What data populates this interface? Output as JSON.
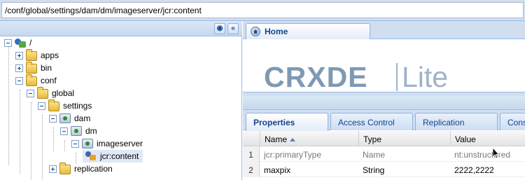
{
  "address": {
    "path": "/conf/global/settings/dam/dm/imageserver/jcr:content"
  },
  "left_header": {
    "buttons": [
      "binoculars-icon",
      "collapse-icon"
    ],
    "collapse_glyph": "«"
  },
  "tree": {
    "nodes": [
      {
        "label": "/",
        "toggle": "minus",
        "icon": "root"
      },
      {
        "label": "apps",
        "toggle": "plus",
        "icon": "folder"
      },
      {
        "label": "bin",
        "toggle": "plus",
        "icon": "folder"
      },
      {
        "label": "conf",
        "toggle": "minus",
        "icon": "folder"
      },
      {
        "label": "global",
        "toggle": "minus",
        "icon": "folder"
      },
      {
        "label": "settings",
        "toggle": "minus",
        "icon": "folder"
      },
      {
        "label": "dam",
        "toggle": "minus",
        "icon": "node"
      },
      {
        "label": "dm",
        "toggle": "minus",
        "icon": "node"
      },
      {
        "label": "imageserver",
        "toggle": "minus",
        "icon": "node"
      },
      {
        "label": "jcr:content",
        "toggle": "none",
        "icon": "content",
        "selected": true
      },
      {
        "label": "replication",
        "toggle": "plus",
        "icon": "folder"
      }
    ]
  },
  "home_tab": {
    "label": "Home"
  },
  "logo": {
    "left": "CRXDE",
    "right": "Lite"
  },
  "props_tabs": [
    {
      "label": "Properties",
      "active": true
    },
    {
      "label": "Access Control",
      "active": false
    },
    {
      "label": "Replication",
      "active": false
    },
    {
      "label": "Cons",
      "active": false
    }
  ],
  "grid": {
    "columns": [
      "Name",
      "Type",
      "Value"
    ],
    "rows": [
      {
        "num": "1",
        "name": "jcr:primaryType",
        "type": "Name",
        "value": "nt:unstructured",
        "muted": true
      },
      {
        "num": "2",
        "name": "maxpix",
        "type": "String",
        "value": "2222,2222",
        "muted": false
      }
    ]
  },
  "colors": {
    "accent": "#15428b",
    "panel_border": "#99bbe8",
    "selected_row": "#dfe8f6"
  }
}
